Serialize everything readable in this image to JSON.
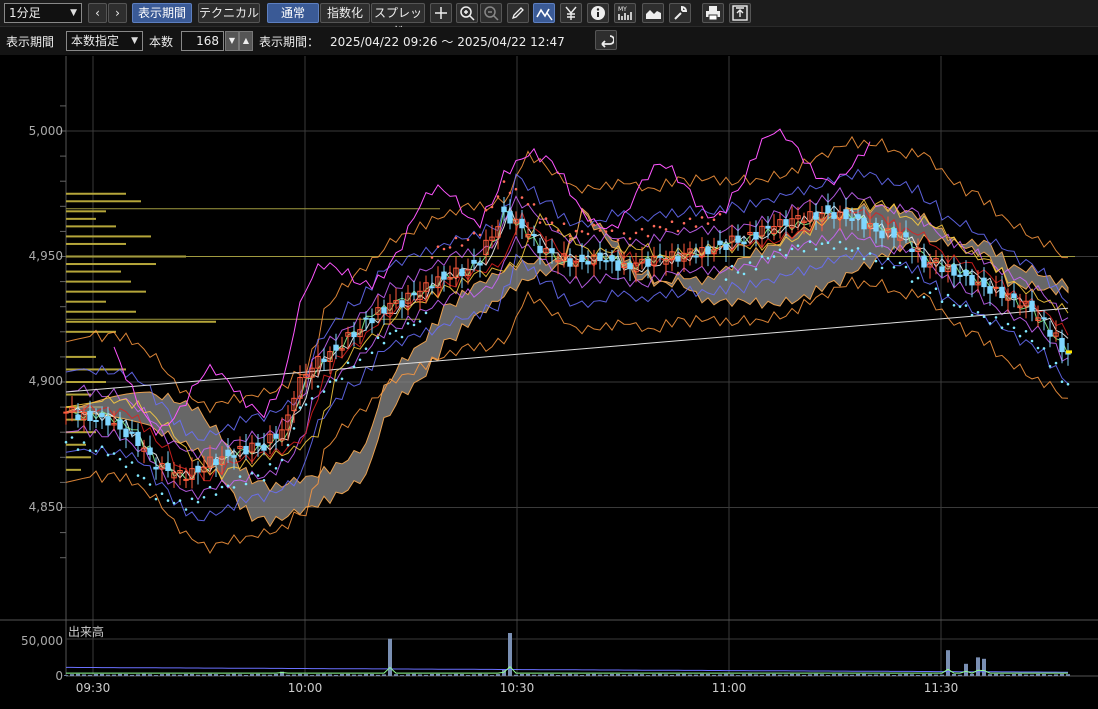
{
  "toolbar": {
    "interval": "1分足",
    "nav_prev": "‹",
    "nav_next": "›",
    "btn_period": "表示期間",
    "btn_technical": "テクニカル",
    "btn_normal": "通常",
    "btn_index": "指数化",
    "btn_spread": "スプレッド",
    "icons": [
      "crosshair-icon",
      "zoom-in-icon",
      "zoom-out-icon",
      "pencil-icon",
      "trend-cursor-icon",
      "yen-icon",
      "info-icon",
      "my-chart-icon",
      "area-chart-icon",
      "wrench-icon",
      "print-icon",
      "export-icon"
    ]
  },
  "period_bar": {
    "label_period": "表示期間",
    "mode": "本数指定",
    "label_count": "本数",
    "count": "168",
    "label_range": "表示期間：",
    "range": "2025/04/22 09:26 ～ 2025/04/22 12:47"
  },
  "axes": {
    "price_labels": [
      "5,000",
      "4,950",
      "4,900",
      "4,850"
    ],
    "volume_label": "50,000",
    "volume_zero": "0",
    "volume_title": "出来高",
    "time_labels": [
      "09:30",
      "10:00",
      "10:30",
      "11:00",
      "11:30"
    ]
  },
  "colors": {
    "up": "#ff5a3c",
    "down": "#7fd6ff",
    "cloud": "#8a8a8a",
    "grid": "#3a3a3a",
    "accent": "#3a5a96"
  },
  "chart_data": {
    "type": "candlestick",
    "price_ylim": [
      4815,
      5030
    ],
    "volume_ylim": [
      0,
      60000
    ],
    "time_range": [
      "09:26",
      "12:47"
    ],
    "grid": true
  }
}
